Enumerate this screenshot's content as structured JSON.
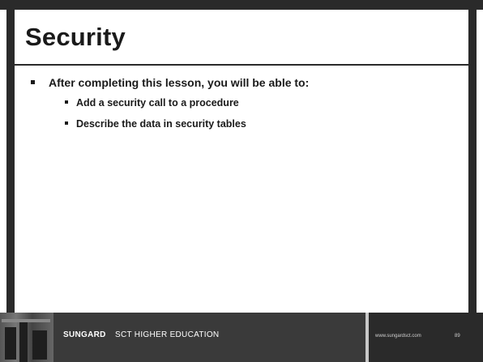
{
  "slide": {
    "title": "Security",
    "bullets": [
      {
        "text": "After completing this lesson, you will be able to:",
        "sub": [
          "Add a security call to a procedure",
          "Describe the data in security tables"
        ]
      }
    ]
  },
  "footer": {
    "brand_bold": "SUNGARD",
    "brand_rest": "SCT HIGHER EDUCATION",
    "url": "www.sungardsct.com",
    "page_number": "89"
  },
  "colors": {
    "frame": "#2a2a2a",
    "text": "#1a1a1a",
    "footer_brand_bg": "#3a3a3a",
    "footer_divider": "#c8c8c8"
  }
}
